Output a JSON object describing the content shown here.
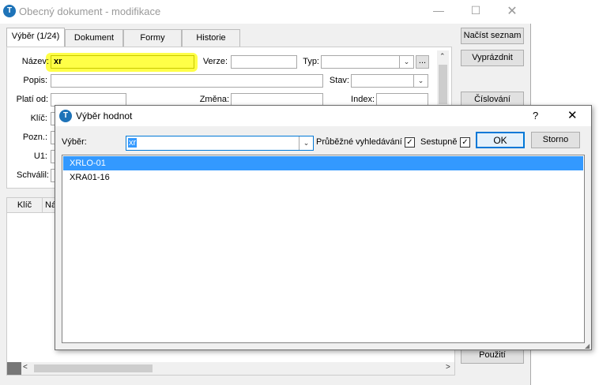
{
  "main_window": {
    "title": "Obecný dokument - modifikace",
    "tabs": [
      {
        "label": "Výběr (1/24)",
        "active": true
      },
      {
        "label": "Dokument",
        "active": false
      },
      {
        "label": "Formy",
        "active": false
      },
      {
        "label": "Historie",
        "active": false
      }
    ],
    "form": {
      "nazev_label": "Název:",
      "nazev_value": "xr",
      "verze_label": "Verze:",
      "typ_label": "Typ:",
      "popis_label": "Popis:",
      "stav_label": "Stav:",
      "plati_od_label": "Platí od:",
      "zmena_label": "Změna:",
      "index_label": "Index:",
      "klic_label": "Klíč:",
      "pozn_label": "Pozn.:",
      "u1_label": "U1:",
      "schvalil_label": "Schválil:",
      "ellipsis_label": "..."
    },
    "grid_headers": [
      "Klíč",
      "Ná"
    ],
    "buttons": {
      "nacist_seznam": "Načíst seznam",
      "vyprazdnit": "Vyprázdnit",
      "cislovani": "Číslování",
      "pouziti": "Použití"
    },
    "highlight_color": "#ffff33"
  },
  "dialog": {
    "title": "Výběr hodnot",
    "help_label": "?",
    "close_label": "✕",
    "vyber_label": "Výběr:",
    "vyber_value": "xr",
    "prubezne_label": "Průběžné vyhledávání",
    "prubezne_checked": true,
    "sestupne_label": "Sestupně",
    "sestupne_checked": true,
    "ok_label": "OK",
    "storno_label": "Storno",
    "items": [
      "XRLO-01",
      "XRA01-16"
    ],
    "selected_index": 0,
    "selection_color": "#3399ff"
  }
}
